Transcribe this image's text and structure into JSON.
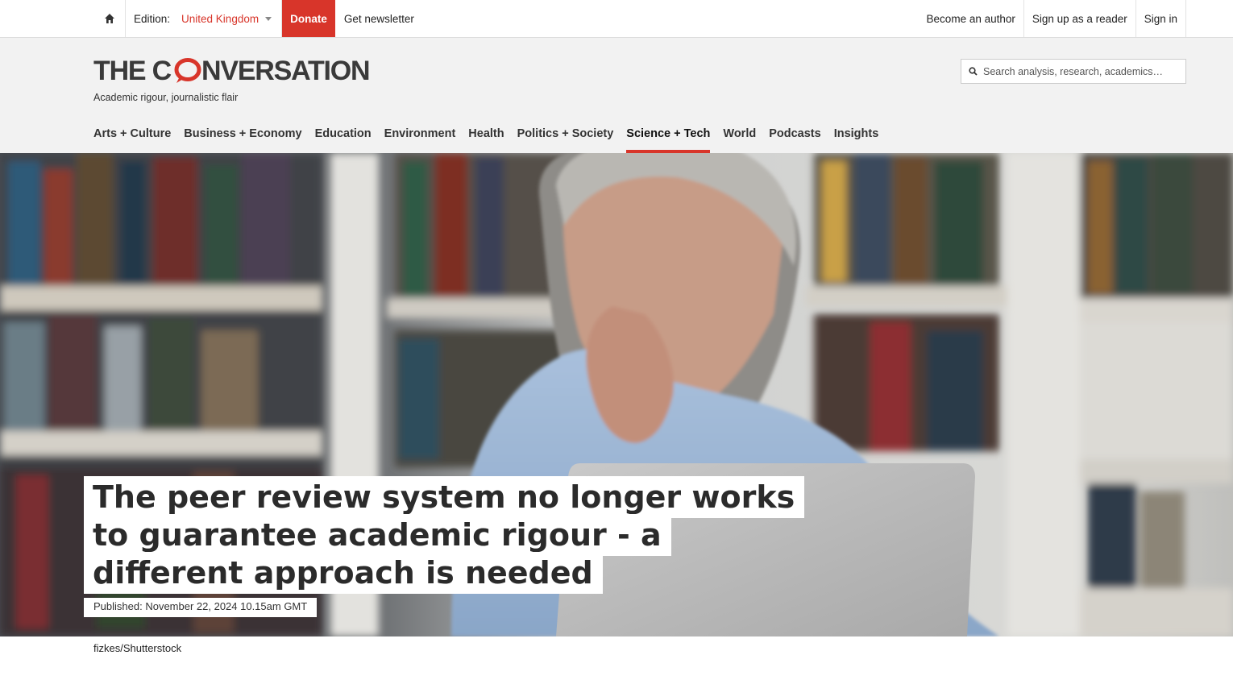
{
  "topbar": {
    "home_icon": "home-icon",
    "edition_label": "Edition:",
    "edition_value": "United Kingdom",
    "donate_label": "Donate",
    "newsletter_label": "Get newsletter",
    "right_links": [
      "Become an author",
      "Sign up as a reader",
      "Sign in"
    ]
  },
  "masthead": {
    "logo_text_part1": "THE C",
    "logo_text_part2": "NVERSATION",
    "tagline": "Academic rigour, journalistic flair",
    "search_placeholder": "Search analysis, research, academics…"
  },
  "nav": {
    "items": [
      "Arts + Culture",
      "Business + Economy",
      "Education",
      "Environment",
      "Health",
      "Politics + Society",
      "Science + Tech",
      "World",
      "Podcasts",
      "Insights"
    ],
    "active": "Science + Tech"
  },
  "article": {
    "headline": "The peer review system no longer works to guarantee academic rigour - a different approach is needed",
    "published": "Published: November 22, 2024 10.15am GMT",
    "image_credit": "fizkes/Shutterstock"
  },
  "colors": {
    "accent": "#d8352a",
    "masthead_bg": "#f2f2f2"
  }
}
